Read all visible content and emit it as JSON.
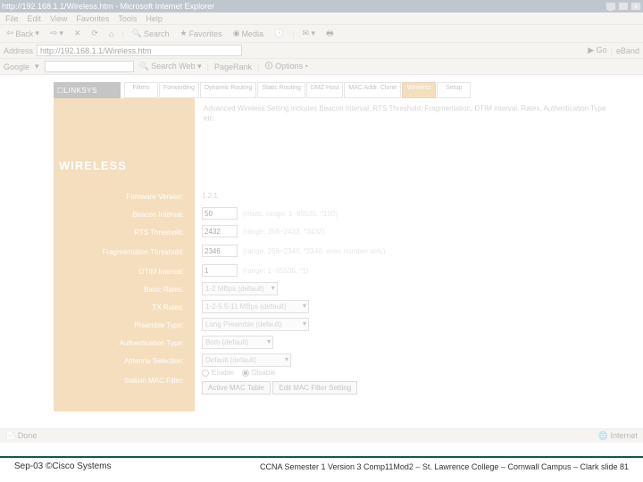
{
  "browser": {
    "title": "http://192.168.1.1/Wireless.htm - Microsoft Internet Explorer",
    "menus": [
      "File",
      "Edit",
      "View",
      "Favorites",
      "Tools",
      "Help"
    ],
    "toolbar": {
      "back": "Back",
      "search": "Search",
      "favorites": "Favorites",
      "media": "Media"
    },
    "address_label": "Address",
    "address_value": "http://192.168.1.1/Wireless.htm",
    "go": "Go",
    "go_side": "eBand",
    "google_label": "Google",
    "google_search": "Search Web",
    "google_pagerank": "PageRank",
    "google_options": "Options",
    "status_left": "Done",
    "status_right": "Internet"
  },
  "router": {
    "brand": "LINKSYS",
    "tabs": [
      {
        "label": "Filters"
      },
      {
        "label": "Forwarding"
      },
      {
        "label": "Dynamic Routing"
      },
      {
        "label": "Static Routing"
      },
      {
        "label": "DMZ Host"
      },
      {
        "label": "MAC Addr. Clone"
      },
      {
        "label": "Wireless"
      },
      {
        "label": "Setup"
      }
    ],
    "active_tab": 6,
    "desc": "Advanced Wireless Setting includes Beacon Interval, RTS Threshold, Fragmentation, DTIM interval, Rates, Authentication Type etc.",
    "heading": "WIRELESS",
    "firmware": {
      "label": "Firmware Version:",
      "value": "1.2.1"
    },
    "fields": {
      "beacon": {
        "label": "Beacon Interval:",
        "value": "50",
        "hint": "(msec, range: 1~65535, *100)"
      },
      "rts": {
        "label": "RTS Threshold:",
        "value": "2432",
        "hint": "(range: 256~2432, *2432)"
      },
      "frag": {
        "label": "Fragmentation Threshold:",
        "value": "2346",
        "hint": "(range: 256~2346, *2346, even number only)"
      },
      "dtim": {
        "label": "DTIM Interval:",
        "value": "1",
        "hint": "(range: 1~65535, *1)"
      },
      "basic": {
        "label": "Basic Rates:",
        "value": "1-2 MBps (default)"
      },
      "tx": {
        "label": "TX Rates:",
        "value": "1-2-5.5-11 MBps (default)"
      },
      "preamble": {
        "label": "Preamble Type:",
        "value": "Long Preamble (default)"
      },
      "auth": {
        "label": "Authentication Type:",
        "value": "Both (default)"
      },
      "antenna": {
        "label": "Antenna Selection:",
        "value": "Default (default)"
      },
      "mac": {
        "label": "Station MAC Filter:",
        "enable": "Enable",
        "disable": "Disable",
        "btn_table": "Active MAC Table",
        "btn_edit": "Edit MAC Filter Setting"
      }
    }
  },
  "footer": {
    "left": "Sep-03 ©Cisco Systems",
    "right": "CCNA Semester 1 Version 3 Comp11Mod2 – St. Lawrence College – Cornwall Campus – Clark slide 81"
  }
}
